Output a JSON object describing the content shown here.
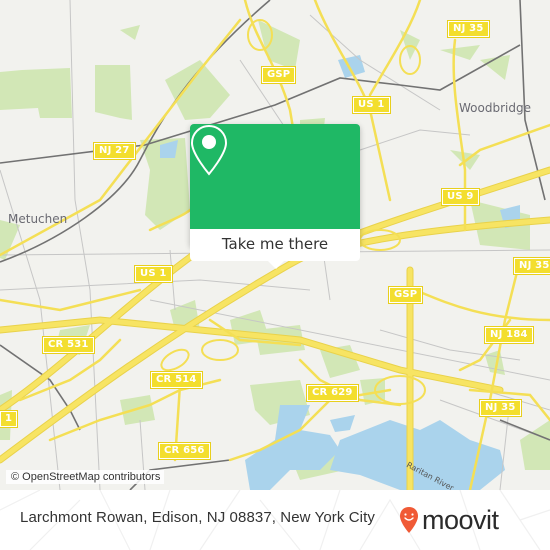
{
  "map": {
    "attribution": "© OpenStreetMap contributors",
    "places": [
      {
        "id": "metuchen",
        "label": "Metuchen"
      },
      {
        "id": "woodbridge",
        "label": "Woodbridge"
      }
    ],
    "water_label": "Raritan River",
    "route_shields": [
      {
        "id": "nj27",
        "label": "NJ 27"
      },
      {
        "id": "gsp-north",
        "label": "GSP"
      },
      {
        "id": "nj35-north",
        "label": "NJ 35"
      },
      {
        "id": "us1-north",
        "label": "US 1"
      },
      {
        "id": "us9",
        "label": "US 9"
      },
      {
        "id": "us1-center",
        "label": "US 1"
      },
      {
        "id": "nj35-east",
        "label": "NJ 35"
      },
      {
        "id": "gsp-south",
        "label": "GSP"
      },
      {
        "id": "cr531",
        "label": "CR 531"
      },
      {
        "id": "nj184",
        "label": "NJ 184"
      },
      {
        "id": "cr514",
        "label": "CR 514"
      },
      {
        "id": "cr629",
        "label": "CR 629"
      },
      {
        "id": "nj35-south",
        "label": "NJ 35"
      },
      {
        "id": "us1-west",
        "label": "1"
      },
      {
        "id": "cr656",
        "label": "CR 656"
      }
    ],
    "colors": {
      "land": "#f2f2ee",
      "park": "#cfe6b0",
      "water": "#a9d4ec",
      "road_major": "#f7e463",
      "rail": "#707070",
      "shield": "#f3de2e"
    }
  },
  "popup": {
    "icon": "map-pin-icon",
    "button_label": "Take me there",
    "accent": "#1fb865"
  },
  "footer": {
    "address": "Larchmont Rowan, Edison, NJ 08837, New York City",
    "brand": "moovit",
    "brand_color": "#f05a36"
  }
}
